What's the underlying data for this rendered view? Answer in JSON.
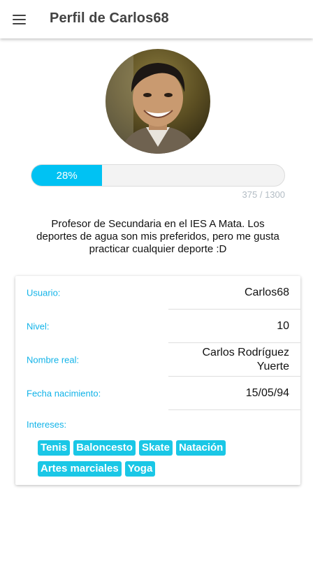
{
  "header": {
    "title": "Perfil de Carlos68",
    "menu_icon": "menu-icon"
  },
  "profile": {
    "avatar_icon": "avatar-photo",
    "progress": {
      "percent_label": "28%",
      "percent": 28,
      "count_label": "375 / 1300"
    },
    "bio": "Profesor de Secundaria en el IES A Mata. Los deportes de agua son mis preferidos, pero me gusta practicar cualquier deporte :D"
  },
  "details": {
    "username": {
      "label": "Usuario:",
      "value": "Carlos68"
    },
    "level": {
      "label": "Nivel:",
      "value": "10"
    },
    "real_name": {
      "label": "Nombre real:",
      "value_line1": "Carlos Rodríguez",
      "value_line2": "Yuerte"
    },
    "birthdate": {
      "label": "Fecha nacimiento:",
      "value": "15/05/94"
    },
    "interests": {
      "label": "Intereses:",
      "tags": [
        "Tenis",
        "Baloncesto",
        "Skate",
        "Natación",
        "Artes marciales",
        "Yoga"
      ]
    }
  },
  "colors": {
    "accent": "#00c2f3",
    "tag": "#1ac7e6",
    "label": "#11b3e8"
  }
}
